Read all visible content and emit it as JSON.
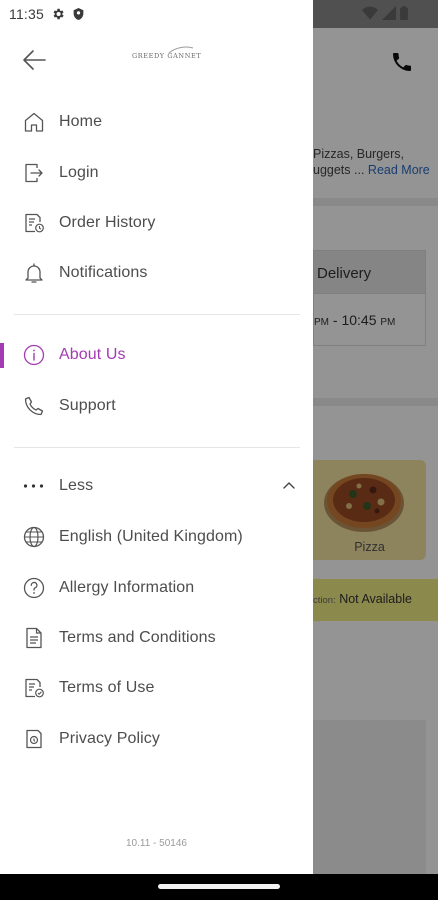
{
  "status_bar": {
    "time": "11:35"
  },
  "drawer": {
    "logo_text": "GREEDY GANNET",
    "menu_primary": [
      {
        "label": "Home",
        "icon": "home-icon"
      },
      {
        "label": "Login",
        "icon": "login-icon"
      },
      {
        "label": "Order History",
        "icon": "order-history-icon"
      },
      {
        "label": "Notifications",
        "icon": "bell-icon"
      }
    ],
    "menu_secondary": [
      {
        "label": "About Us",
        "icon": "info-icon",
        "active": true
      },
      {
        "label": "Support",
        "icon": "phone-icon"
      }
    ],
    "less_label": "Less",
    "menu_more": [
      {
        "label": "English (United Kingdom)",
        "icon": "globe-icon"
      },
      {
        "label": "Allergy Information",
        "icon": "help-circle-icon"
      },
      {
        "label": "Terms and Conditions",
        "icon": "document-icon"
      },
      {
        "label": "Terms of Use",
        "icon": "terms-icon"
      },
      {
        "label": "Privacy Policy",
        "icon": "privacy-icon"
      }
    ],
    "version": "10.11 - 50146"
  },
  "background": {
    "description_line1": "Pizzas, Burgers,",
    "description_line2": "uggets ...",
    "read_more": "Read More",
    "delivery_label": "Delivery",
    "delivery_time_prefix": "PM",
    "delivery_time_main": " - 10:45 ",
    "delivery_time_suffix": "PM",
    "pizza_label": "Pizza",
    "notice_prefix": "ction:",
    "notice_value": "Not Available"
  },
  "colors": {
    "accent": "#a33bb2",
    "text": "#4d4d4d",
    "scrim": "rgba(0,0,0,0.42)"
  }
}
